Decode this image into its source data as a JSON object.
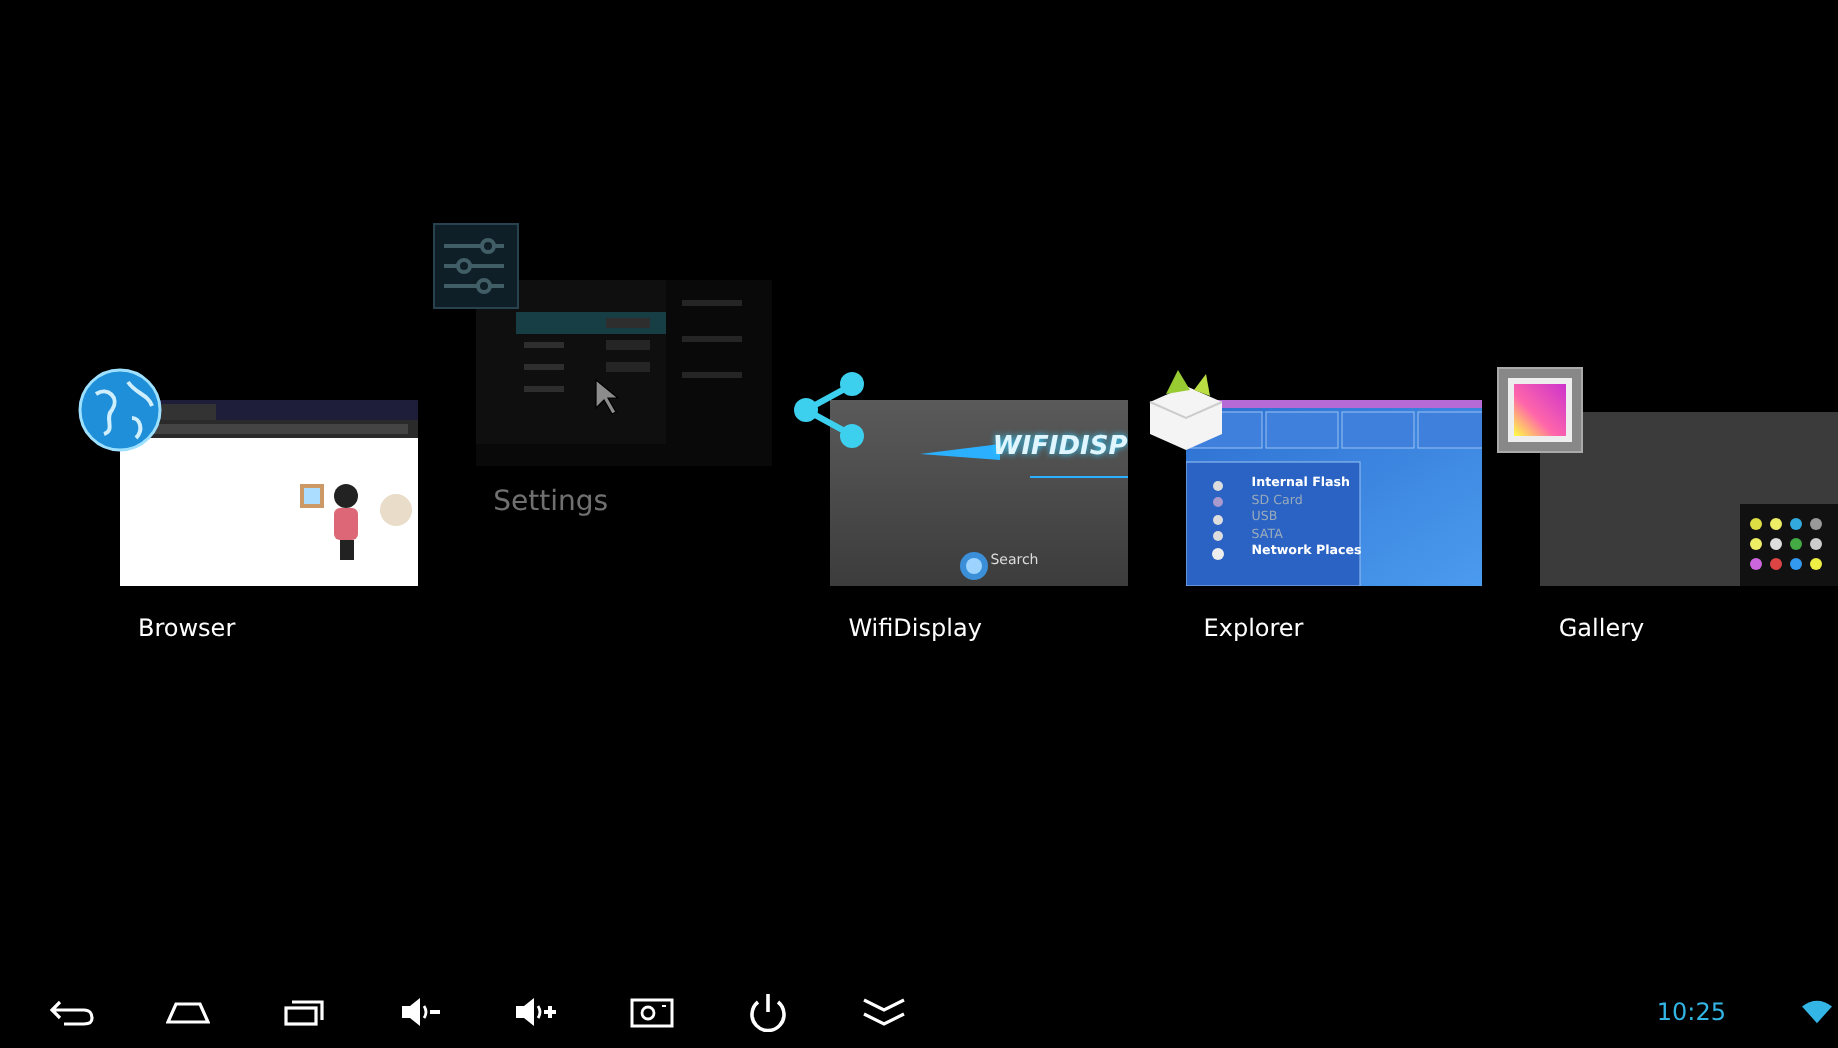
{
  "apps": [
    {
      "name": "Browser",
      "kind": "browser",
      "dismissing": false
    },
    {
      "name": "Settings",
      "kind": "settings",
      "dismissing": true
    },
    {
      "name": "WifiDisplay",
      "kind": "wifidisplay",
      "dismissing": false,
      "thumbnail": {
        "logo": "WIFIDISP",
        "button": "Search"
      }
    },
    {
      "name": "Explorer",
      "kind": "explorer",
      "dismissing": false,
      "thumbnail": {
        "items": [
          {
            "label": "Internal Flash",
            "available": true
          },
          {
            "label": "SD Card",
            "available": false
          },
          {
            "label": "USB",
            "available": false
          },
          {
            "label": "SATA",
            "available": false
          },
          {
            "label": "Network Places",
            "available": true
          }
        ]
      }
    },
    {
      "name": "Gallery",
      "kind": "gallery",
      "dismissing": false
    }
  ],
  "status": {
    "time": "10:25"
  }
}
